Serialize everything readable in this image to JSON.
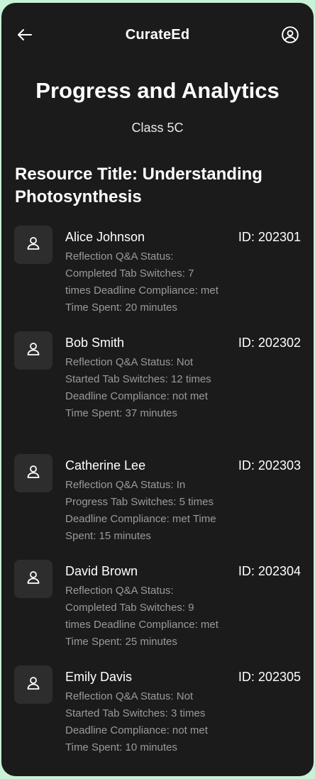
{
  "header": {
    "app_title": "CurateEd",
    "back_icon": "arrow-left-icon",
    "profile_icon": "user-circle-icon"
  },
  "page": {
    "title": "Progress and Analytics",
    "class_name": "Class 5C",
    "resource_title": "Resource Title: Understanding Photosynthesis"
  },
  "students": [
    {
      "name": "Alice Johnson",
      "id": "ID: 202301",
      "details": "Reflection Q&A Status: Completed Tab Switches: 7 times Deadline Compliance: met Time Spent: 20 minutes"
    },
    {
      "name": "Bob Smith",
      "id": "ID: 202302",
      "details": "Reflection Q&A Status: Not Started Tab Switches: 12 times Deadline Compliance: not met Time Spent: 37 minutes"
    },
    {
      "name": "Catherine Lee",
      "id": "ID: 202303",
      "details": "Reflection Q&A Status: In Progress Tab Switches: 5 times Deadline Compliance: met Time Spent: 15 minutes"
    },
    {
      "name": "David Brown",
      "id": "ID: 202304",
      "details": "Reflection Q&A Status: Completed Tab Switches: 9 times Deadline Compliance: met Time Spent: 25 minutes"
    },
    {
      "name": "Emily Davis",
      "id": "ID: 202305",
      "details": "Reflection Q&A Status: Not Started Tab Switches: 3 times Deadline Compliance: not met Time Spent: 10 minutes"
    }
  ],
  "colors": {
    "background": "#1b1b1b",
    "page_background": "#c9f1d6",
    "avatar_tile": "#2d2d2d",
    "muted_text": "#9a9a9a"
  }
}
